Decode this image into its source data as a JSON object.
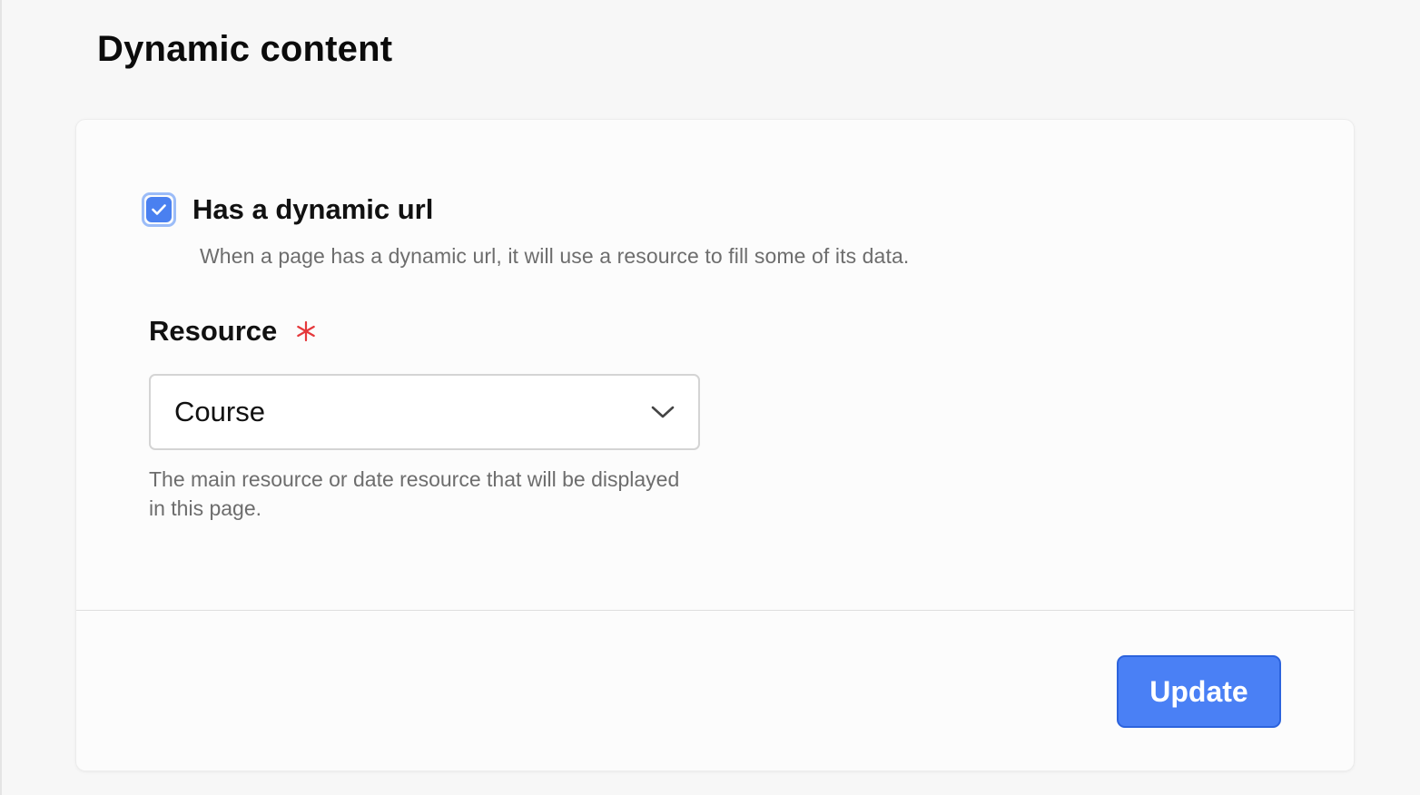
{
  "page": {
    "title": "Dynamic content"
  },
  "dynamic_url": {
    "checked": true,
    "label": "Has a dynamic url",
    "help": "When a page has a dynamic url, it will use a resource to fill some of its data."
  },
  "resource": {
    "label": "Resource",
    "required_mark": "*",
    "selected_value": "Course",
    "help": "The main resource or date resource that will be displayed in this page."
  },
  "footer": {
    "update_label": "Update"
  },
  "colors": {
    "accent": "#4a80f5",
    "required": "#e5383b"
  }
}
